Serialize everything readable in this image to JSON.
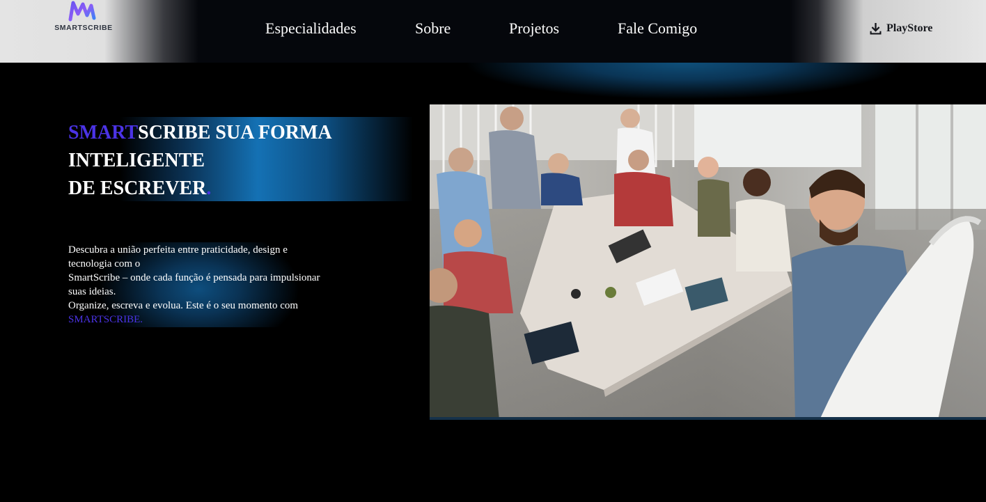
{
  "brand": {
    "logo_text": "SMARTSCRIBE"
  },
  "nav": {
    "items": [
      {
        "label": "Especialidades"
      },
      {
        "label": "Sobre"
      },
      {
        "label": "Projetos"
      },
      {
        "label": "Fale Comigo"
      }
    ],
    "download_label": "PlayStore"
  },
  "hero": {
    "title_accent": "SMART",
    "title_line1": "SCRIBE SUA FORMA",
    "title_line2": "INTELIGENTE",
    "title_line3": "DE ESCREVER",
    "title_dot": ".",
    "paragraph": {
      "line1": "Descubra a união perfeita entre praticidade, design e tecnologia com o",
      "line2": "SmartScribe – onde cada função é pensada para impulsionar suas ideias.",
      "line3": "Organize, escreva e evolua. Este é o seu momento com",
      "brand": "SMARTSCRIBE."
    }
  },
  "colors": {
    "accent": "#4b33e6",
    "background": "#000000",
    "glow": "#1471b4"
  },
  "icons": {
    "logo": "smartscribe-logo-icon",
    "download": "download-icon"
  }
}
